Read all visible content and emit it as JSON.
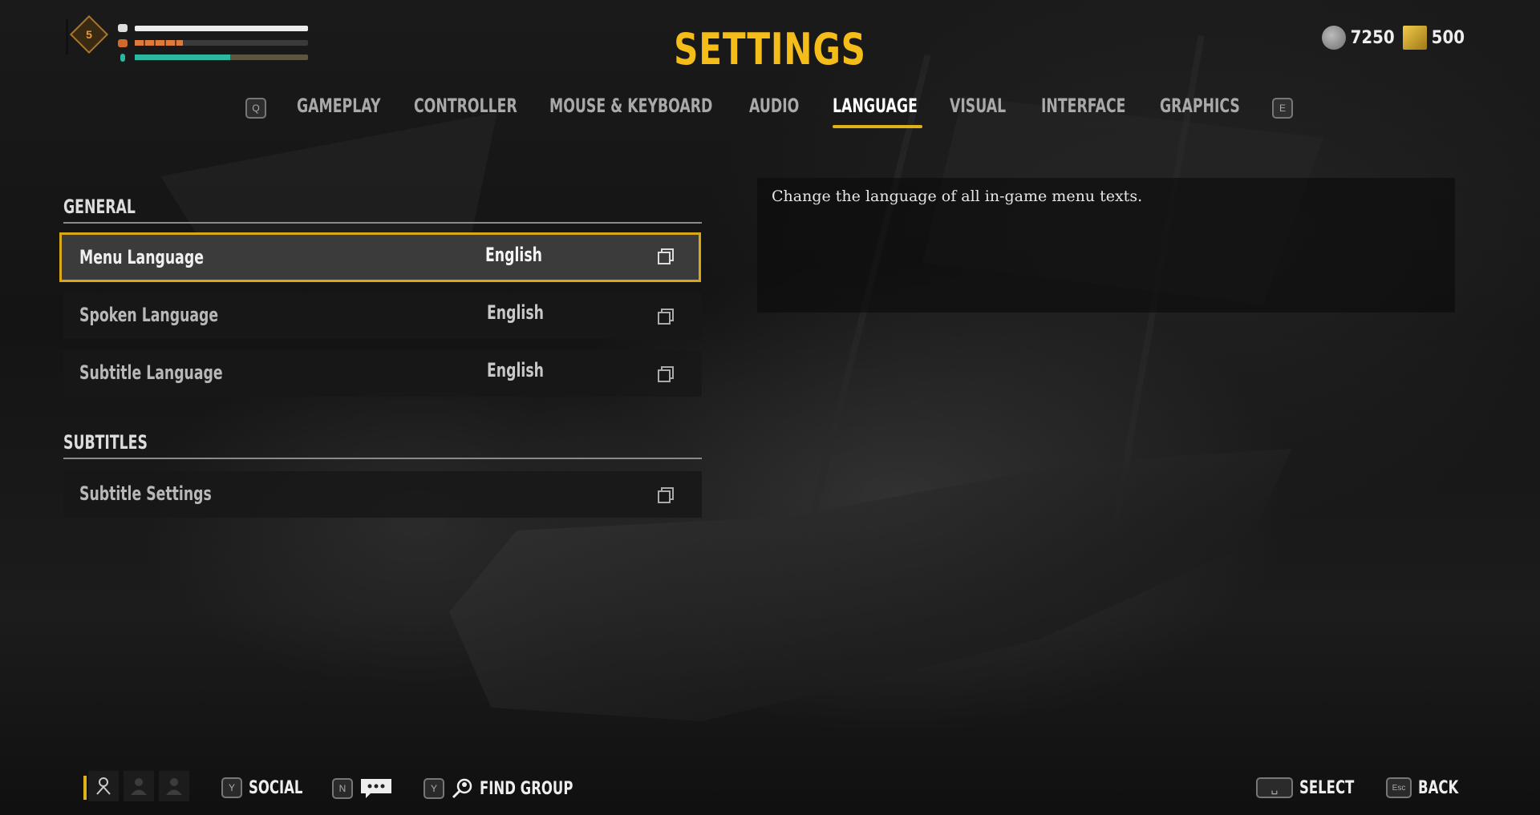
{
  "hud": {
    "level": "5",
    "health_percent": 100,
    "ammo_percent": 28,
    "energy_percent": 55,
    "currency": [
      {
        "icon": "silver-coin-icon",
        "value": "7250"
      },
      {
        "icon": "gold-bar-icon",
        "value": "500"
      }
    ]
  },
  "header": {
    "title": "SETTINGS",
    "prev_key": "Q",
    "next_key": "E",
    "tabs": [
      {
        "label": "GAMEPLAY",
        "active": false
      },
      {
        "label": "CONTROLLER",
        "active": false
      },
      {
        "label": "MOUSE & KEYBOARD",
        "active": false
      },
      {
        "label": "AUDIO",
        "active": false
      },
      {
        "label": "LANGUAGE",
        "active": true
      },
      {
        "label": "VISUAL",
        "active": false
      },
      {
        "label": "INTERFACE",
        "active": false
      },
      {
        "label": "GRAPHICS",
        "active": false
      }
    ]
  },
  "sections": [
    {
      "title": "GENERAL",
      "rows": [
        {
          "label": "Menu Language",
          "value": "English",
          "icon": "dropdown-icon",
          "selected": true
        },
        {
          "label": "Spoken Language",
          "value": "English",
          "icon": "dropdown-icon",
          "selected": false
        },
        {
          "label": "Subtitle Language",
          "value": "English",
          "icon": "dropdown-icon",
          "selected": false
        }
      ]
    },
    {
      "title": "SUBTITLES",
      "rows": [
        {
          "label": "Subtitle Settings",
          "value": "",
          "icon": "dropdown-icon",
          "selected": false
        }
      ]
    }
  ],
  "description": "Change the language of all in-game menu texts.",
  "footer": {
    "social_key": "Y",
    "social_label": "SOCIAL",
    "chat_key": "N",
    "find_group_key": "Y",
    "find_group_label": "FIND GROUP",
    "select_key": "␣",
    "select_label": "SELECT",
    "back_key": "Esc",
    "back_label": "BACK"
  },
  "colors": {
    "accent": "#f5bd1a",
    "selection_border": "#d8a818",
    "energy": "#2bb7a0",
    "ammo": "#e07a3a"
  }
}
